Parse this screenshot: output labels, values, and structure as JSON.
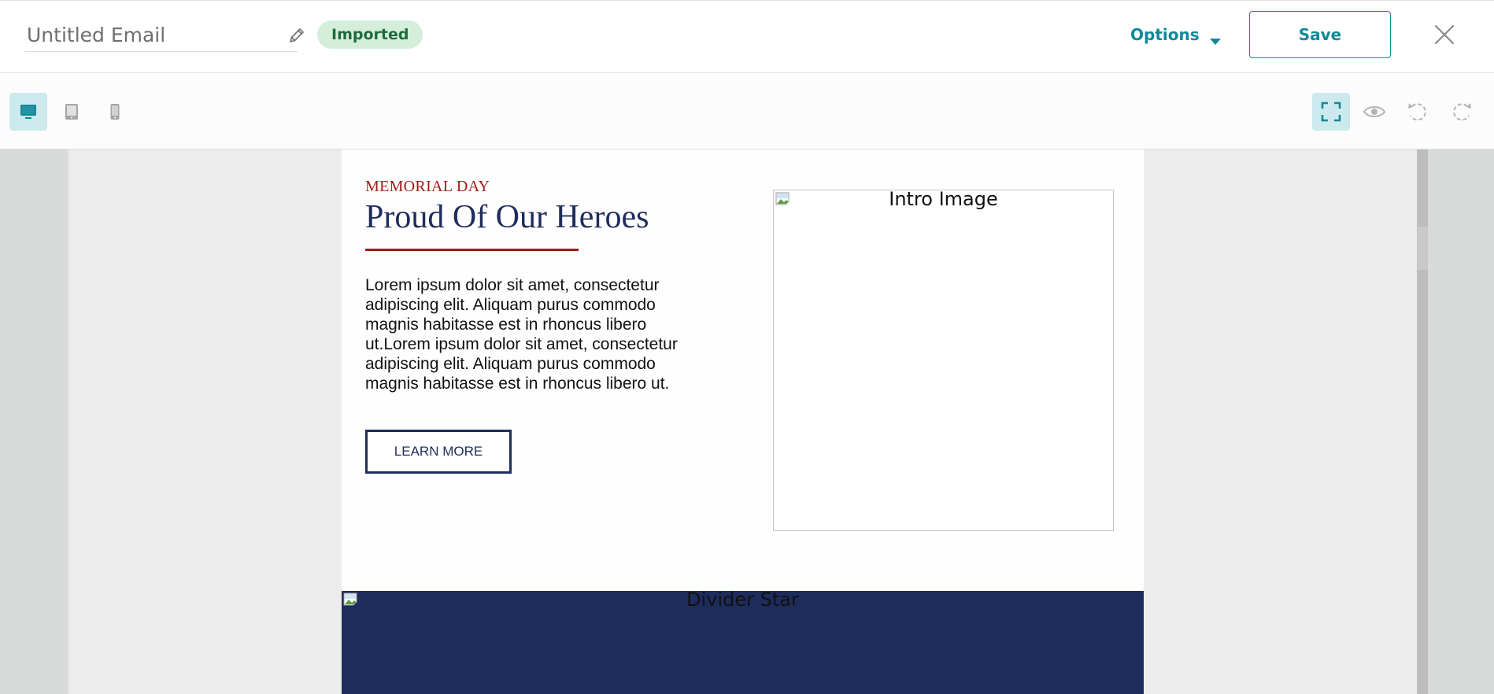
{
  "header": {
    "title_placeholder": "Untitled Email",
    "badge": "Imported",
    "options_label": "Options",
    "save_label": "Save"
  },
  "toolbar": {
    "device_buttons": [
      "desktop",
      "tablet",
      "mobile"
    ],
    "active_device": "desktop",
    "right_buttons": [
      "fullscreen",
      "preview",
      "undo",
      "redo"
    ],
    "active_right": "fullscreen"
  },
  "colors": {
    "accent": "#12889a",
    "badge_bg": "#d5eedc",
    "badge_text": "#1f6b3a",
    "navy": "#1f2d5c",
    "red": "#a11c17"
  },
  "email": {
    "eyebrow": "MEMORIAL DAY",
    "headline": "Proud Of Our Heroes",
    "body": "Lorem ipsum dolor sit amet, consectetur adipiscing elit. Aliquam purus commodo magnis habitasse est in rhoncus libero ut.Lorem ipsum dolor sit amet, consectetur adipiscing elit. Aliquam purus commodo magnis habitasse est in rhoncus libero ut.",
    "cta_label": "LEARN MORE",
    "intro_image_alt": "Intro Image",
    "divider_alt": "Divider Star"
  }
}
